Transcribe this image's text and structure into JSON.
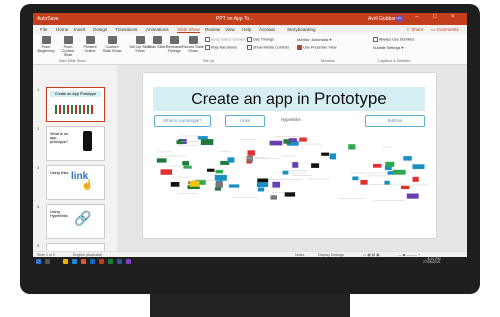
{
  "titlebar": {
    "autosave": "AutoSave",
    "doc": "PPT on App To...",
    "user": "Avril Gubbard",
    "user_initials": "AG"
  },
  "tabs": [
    "File",
    "Home",
    "Insert",
    "Design",
    "Transitions",
    "Animations",
    "Slide Show",
    "Review",
    "View",
    "Help",
    "Acrobat",
    "Storyboarding"
  ],
  "active_tab": "Slide Show",
  "share": "Share",
  "comments": "Comments",
  "ribbon": {
    "start": [
      {
        "label": "From Beginning"
      },
      {
        "label": "From Current Slide"
      },
      {
        "label": "Present Online"
      },
      {
        "label": "Custom Slide Show"
      }
    ],
    "start_group": "Start Slide Show",
    "setup": [
      {
        "label": "Set Up Slide Show"
      },
      {
        "label": "Hide Slide"
      },
      {
        "label": "Rehearse Timings"
      },
      {
        "label": "Record Slide Show"
      }
    ],
    "keep_updated": "Keep Slides Updated",
    "play_narrations": "Play Narrations",
    "use_timings": "Use Timings",
    "show_media": "Show Media Controls",
    "setup_group": "Set Up",
    "monitor_label": "Monitor:",
    "monitor_value": "Automatic",
    "presenter_view": "Use Presenter View",
    "monitors_group": "Monitors",
    "always_subtitles": "Always Use Subtitles",
    "subtitle_settings": "Subtitle Settings",
    "captions_group": "Captions & Subtitles"
  },
  "thumbs": [
    {
      "num": "1",
      "title": "Create an App Prototype"
    },
    {
      "num": "2",
      "title": "What is an app prototype?"
    },
    {
      "num": "3",
      "title": "Using links"
    },
    {
      "num": "4",
      "title": "Using Hyperlinks"
    },
    {
      "num": "5",
      "title": ""
    }
  ],
  "slide": {
    "title_a": "Create an app in",
    "title_b": "Prototype",
    "box1": "What is a prototype?",
    "box2": "Links",
    "text3": "Hyperlinks",
    "box4": "Buttons"
  },
  "status": {
    "slide": "Slide 1 of 5",
    "lang": "English (Australia)",
    "notes": "Notes",
    "display": "Display Settings"
  },
  "tray": {
    "time": "8:01 PM",
    "date": "27/09/2021"
  },
  "colors": {
    "accent": "#c43e1c",
    "banner": "#d6eff4"
  }
}
